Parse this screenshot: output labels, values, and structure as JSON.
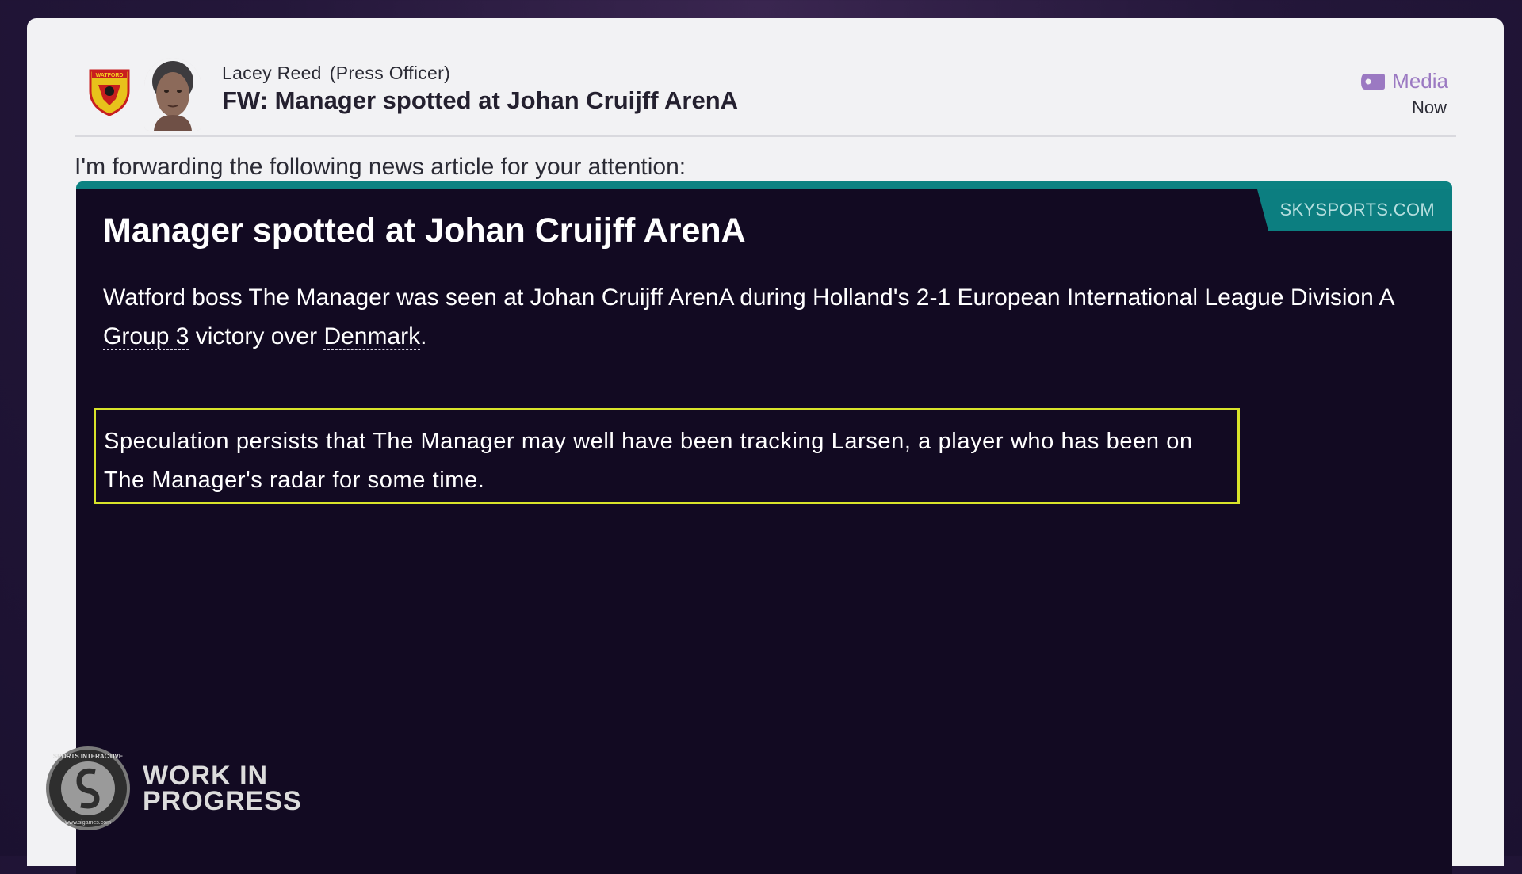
{
  "header": {
    "sender_name": "Lacey Reed",
    "sender_role": "(Press Officer)",
    "subject": "FW: Manager spotted at Johan Cruijff ArenA",
    "category": "Media",
    "time": "Now",
    "club_badge_text": "WATFORD"
  },
  "intro_text": "I'm forwarding the following news article for your attention:",
  "article": {
    "source": "SKYSPORTS.COM",
    "headline": "Manager spotted at Johan Cruijff ArenA",
    "p1": {
      "club": "Watford",
      "t1": " boss ",
      "manager": "The Manager",
      "t2": " was seen at ",
      "stadium": "Johan Cruijff ArenA",
      "t3": " during ",
      "nation": "Holland",
      "t4": "'s ",
      "score": "2-1",
      "t5": " ",
      "competition": "European International League Division A Group 3",
      "t6": " victory over ",
      "opponent": "Denmark",
      "t7": "."
    },
    "highlight": "Speculation persists that The Manager may well have been tracking Larsen, a player who has been on The Manager's radar for some time."
  },
  "watermark": {
    "logo_text": "SPORTS INTERACTIVE",
    "url_text": "www.sigames.com",
    "line1": "WORK IN",
    "line2": "PROGRESS"
  },
  "colors": {
    "article_bg": "#120a22",
    "teal_accent": "#0c8282",
    "highlight_border": "#d8e32a",
    "media_purple": "#9b79c2"
  }
}
